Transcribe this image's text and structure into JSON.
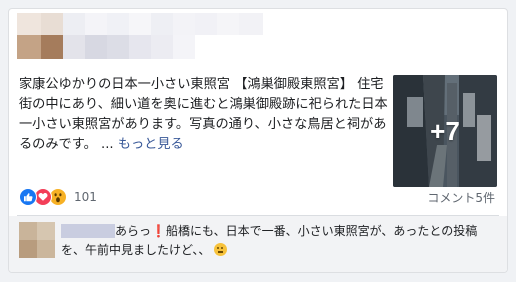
{
  "post": {
    "text": "家康公ゆかりの日本一小さい東照宮 【鴻巣御殿東照宮】 住宅街の中にあり、細い道を奥に進むと鴻巣御殿跡に祀られた日本一小さい東照宮があります。写真の通り、小さな鳥居と祠があるのみです。",
    "ellipsis": "...",
    "see_more": "もっと見る",
    "more_photos": "+7"
  },
  "reactions": {
    "count": "101",
    "icons": [
      "like-icon",
      "love-icon",
      "wow-icon"
    ]
  },
  "comments_count": "コメント5件",
  "comment": {
    "text_before": "あらっ",
    "exclamation": "❗",
    "text_after": "船橋にも、日本で一番、小さい東照宮が、あったとの投稿を、午前中見ましたけど、、"
  },
  "colors": {
    "link": "#385898",
    "like": "#1877f2",
    "love": "#f33e58",
    "wow": "#f7b125",
    "secondary_text": "#606770"
  }
}
